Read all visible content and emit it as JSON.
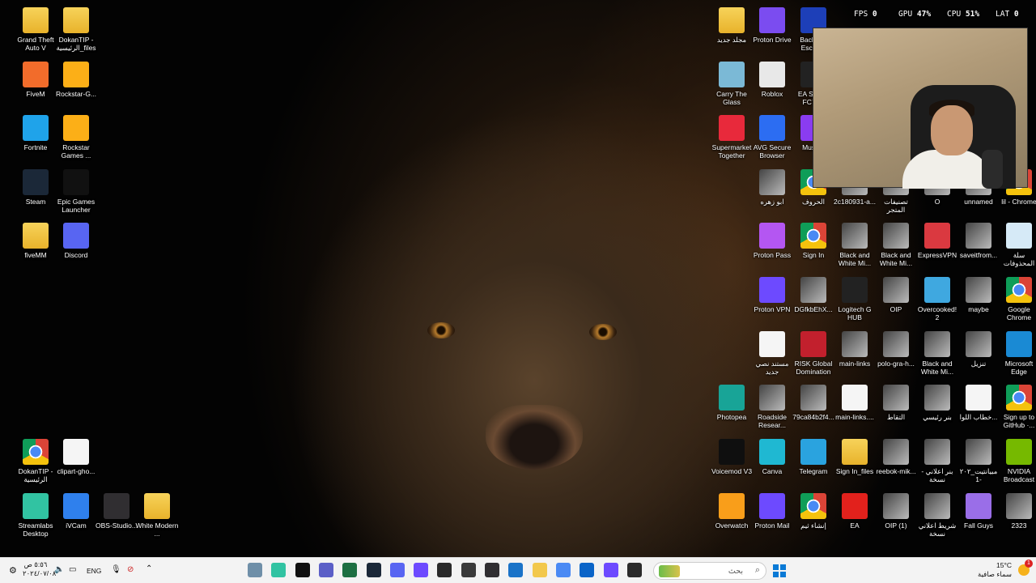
{
  "desktop": {
    "left_icons": [
      {
        "label": "Grand Theft Auto V",
        "icon": "folder-icon",
        "type": "folder"
      },
      {
        "label": "DokanTIP - الرئيسية_files",
        "icon": "folder-icon",
        "type": "folder"
      },
      {
        "label": "FiveM",
        "icon": "fivem-icon",
        "type": "app",
        "color": "#f26c2b"
      },
      {
        "label": "Rockstar-G...",
        "icon": "rockstar-icon",
        "type": "app",
        "color": "#fcaf17"
      },
      {
        "label": "Fortnite",
        "icon": "fortnite-icon",
        "type": "app",
        "color": "#1fa3ea"
      },
      {
        "label": "Rockstar Games ...",
        "icon": "rockstar-icon",
        "type": "app",
        "color": "#fcaf17"
      },
      {
        "label": "Steam",
        "icon": "steam-icon",
        "type": "app",
        "color": "#1b2838"
      },
      {
        "label": "Epic Games Launcher",
        "icon": "epic-games-icon",
        "type": "app",
        "color": "#111111"
      },
      {
        "label": "fiveMM",
        "icon": "folder-icon",
        "type": "folder"
      },
      {
        "label": "Discord",
        "icon": "discord-icon",
        "type": "app",
        "color": "#5865f2"
      },
      {
        "label": "DokanTIP - الرئيسية",
        "icon": "chrome-icon",
        "type": "chrome"
      },
      {
        "label": "clipart-gho...",
        "icon": "ghost-image-icon",
        "type": "file"
      },
      {
        "label": "Streamlabs Desktop",
        "icon": "streamlabs-icon",
        "type": "app",
        "color": "#31c3a2"
      },
      {
        "label": "iVCam",
        "icon": "ivcam-icon",
        "type": "app",
        "color": "#2f80ed"
      },
      {
        "label": "OBS-Studio...",
        "icon": "obs-icon",
        "type": "app",
        "color": "#302e31"
      },
      {
        "label": "White Modern ...",
        "icon": "folder-icon",
        "type": "folder"
      }
    ],
    "right_icons": [
      {
        "label": "مجلد جديد",
        "icon": "folder-icon",
        "type": "folder"
      },
      {
        "label": "Proton Drive",
        "icon": "proton-drive-icon",
        "type": "app",
        "color": "#7b4cf0"
      },
      {
        "label": "Backro... Escap...",
        "icon": "bet-icon",
        "type": "app",
        "color": "#1d3fb8"
      },
      {
        "label": "Carry The Glass",
        "icon": "carry-glass-icon",
        "type": "app",
        "color": "#7bb9d6"
      },
      {
        "label": "Roblox",
        "icon": "roblox-icon",
        "type": "app",
        "color": "#e8e8e8"
      },
      {
        "label": "EA SPO... FC™...",
        "icon": "ea-fc-icon",
        "type": "app",
        "color": "#222222"
      },
      {
        "label": "Supermarket Together",
        "icon": "supermarket-icon",
        "type": "app",
        "color": "#e8293b"
      },
      {
        "label": "AVG Secure Browser",
        "icon": "avg-icon",
        "type": "app",
        "color": "#2c6df2"
      },
      {
        "label": "Muse...",
        "icon": "muse-icon",
        "type": "app",
        "color": "#8a3cf0"
      },
      {
        "label": "ابو زهره",
        "icon": "photo-thumbnail-icon",
        "type": "thumb"
      },
      {
        "label": "الحروف",
        "icon": "chrome-icon",
        "type": "chrome"
      },
      {
        "label": "2c180931-a...",
        "icon": "photo-thumbnail-icon",
        "type": "thumb"
      },
      {
        "label": "تصنيفات المتجر",
        "icon": "photo-thumbnail-icon",
        "type": "thumb"
      },
      {
        "label": "O",
        "icon": "photo-thumbnail-icon",
        "type": "thumb"
      },
      {
        "label": "unnamed",
        "icon": "photo-thumbnail-icon",
        "type": "thumb"
      },
      {
        "label": "lil - Chrome",
        "icon": "chrome-icon",
        "type": "chrome"
      },
      {
        "label": "Proton Pass",
        "icon": "proton-pass-icon",
        "type": "app",
        "color": "#b456f2"
      },
      {
        "label": "Sign In",
        "icon": "chrome-icon",
        "type": "chrome"
      },
      {
        "label": "Black and White Mi...",
        "icon": "photo-thumbnail-icon",
        "type": "thumb"
      },
      {
        "label": "Black and White Mi...",
        "icon": "photo-thumbnail-icon",
        "type": "thumb"
      },
      {
        "label": "ExpressVPN",
        "icon": "expressvpn-icon",
        "type": "app",
        "color": "#da3940"
      },
      {
        "label": "saveitfrom...",
        "icon": "photo-thumbnail-icon",
        "type": "thumb"
      },
      {
        "label": "سلة المحذوفات",
        "icon": "recycle-bin-icon",
        "type": "app",
        "color": "#d6eaf7"
      },
      {
        "label": "Proton VPN",
        "icon": "proton-vpn-icon",
        "type": "app",
        "color": "#6d4aff"
      },
      {
        "label": "DGfkbEhX...",
        "icon": "photo-thumbnail-icon",
        "type": "thumb"
      },
      {
        "label": "Logitech G HUB",
        "icon": "logitech-icon",
        "type": "app",
        "color": "#222222"
      },
      {
        "label": "OIP",
        "icon": "photo-thumbnail-icon",
        "type": "thumb"
      },
      {
        "label": "Overcooked! 2",
        "icon": "overcooked-icon",
        "type": "app",
        "color": "#3fa8e0"
      },
      {
        "label": "maybe",
        "icon": "photo-thumbnail-icon",
        "type": "thumb"
      },
      {
        "label": "Google Chrome",
        "icon": "chrome-icon",
        "type": "chrome"
      },
      {
        "label": "مستند نصي جديد",
        "icon": "text-file-icon",
        "type": "file"
      },
      {
        "label": "RISK Global Domination",
        "icon": "risk-icon",
        "type": "app",
        "color": "#c2202d"
      },
      {
        "label": "main-links",
        "icon": "photo-thumbnail-icon",
        "type": "thumb"
      },
      {
        "label": "polo-gra-h...",
        "icon": "photo-thumbnail-icon",
        "type": "thumb"
      },
      {
        "label": "Black and White Mi...",
        "icon": "photo-thumbnail-icon",
        "type": "thumb"
      },
      {
        "label": "تنزيل",
        "icon": "photo-thumbnail-icon",
        "type": "thumb"
      },
      {
        "label": "Microsoft Edge",
        "icon": "edge-icon",
        "type": "app",
        "color": "#1a8ad4"
      },
      {
        "label": "Photopea",
        "icon": "photopea-icon",
        "type": "app",
        "color": "#18a497"
      },
      {
        "label": "Roadside Resear...",
        "icon": "photo-thumbnail-icon",
        "type": "thumb"
      },
      {
        "label": "79ca84b2f4...",
        "icon": "photo-thumbnail-icon",
        "type": "thumb"
      },
      {
        "label": "main-links....",
        "icon": "text-file-icon",
        "type": "file"
      },
      {
        "label": "التقاط",
        "icon": "photo-thumbnail-icon",
        "type": "thumb"
      },
      {
        "label": "بنر رئيسي",
        "icon": "photo-thumbnail-icon",
        "type": "thumb"
      },
      {
        "label": "خطاب اللوا...",
        "icon": "text-file-icon",
        "type": "file"
      },
      {
        "label": "Sign up to GitHub ·...",
        "icon": "chrome-icon",
        "type": "chrome"
      },
      {
        "label": "Voicemod V3",
        "icon": "voicemod-icon",
        "type": "app",
        "color": "#0f0f0f"
      },
      {
        "label": "Canva",
        "icon": "canva-icon",
        "type": "app",
        "color": "#1fb8d2"
      },
      {
        "label": "Telegram",
        "icon": "telegram-icon",
        "type": "app",
        "color": "#2aa3df"
      },
      {
        "label": "Sign In_files",
        "icon": "folder-icon",
        "type": "folder"
      },
      {
        "label": "reebok-mik...",
        "icon": "photo-thumbnail-icon",
        "type": "thumb"
      },
      {
        "label": "بنر اعلاني - نسخة",
        "icon": "photo-thumbnail-icon",
        "type": "thumb"
      },
      {
        "label": "مبيانتيت_٢٠٢ -1",
        "icon": "photo-thumbnail-icon",
        "type": "thumb"
      },
      {
        "label": "NVIDIA Broadcast",
        "icon": "nvidia-icon",
        "type": "app",
        "color": "#76b900"
      },
      {
        "label": "Overwatch",
        "icon": "overwatch-icon",
        "type": "app",
        "color": "#f99e1a"
      },
      {
        "label": "Proton Mail",
        "icon": "proton-mail-icon",
        "type": "app",
        "color": "#6d4aff"
      },
      {
        "label": "إنشاء ثيم",
        "icon": "chrome-icon",
        "type": "chrome"
      },
      {
        "label": "EA",
        "icon": "ea-icon",
        "type": "app",
        "color": "#e2211c"
      },
      {
        "label": "OIP (1)",
        "icon": "photo-thumbnail-icon",
        "type": "thumb"
      },
      {
        "label": "شريط اعلاني نسخة",
        "icon": "photo-thumbnail-icon",
        "type": "thumb"
      },
      {
        "label": "Fall Guys",
        "icon": "fall-guys-icon",
        "type": "app",
        "color": "#9a6ee8"
      },
      {
        "label": "2323",
        "icon": "photo-thumbnail-icon",
        "type": "thumb"
      }
    ]
  },
  "overlay": {
    "fps_label": "FPS",
    "fps_value": "0",
    "gpu_label": "GPU",
    "gpu_value": "47%",
    "cpu_label": "CPU",
    "cpu_value": "51%",
    "lat_label": "LAT",
    "lat_value": "0"
  },
  "taskbar": {
    "search_placeholder": "بحث",
    "language": "ENG",
    "time": "٥:٥٦ ص",
    "date": "٢٠٢٤/٠٧/٠٨",
    "weather_temp": "15°C",
    "weather_desc": "سماء صافية",
    "notification_count": "1",
    "pinned": [
      {
        "icon": "photos-icon",
        "color": "#6f8fa8"
      },
      {
        "icon": "streamlabs-icon",
        "color": "#31c3a2"
      },
      {
        "icon": "capcut-icon",
        "color": "#111111"
      },
      {
        "icon": "teams-icon",
        "color": "#5b5fc7"
      },
      {
        "icon": "excel-icon",
        "color": "#1d6f42"
      },
      {
        "icon": "steam-icon",
        "color": "#1b2838"
      },
      {
        "icon": "discord-icon",
        "color": "#5865f2"
      },
      {
        "icon": "headset-icon",
        "color": "#6d4aff"
      },
      {
        "icon": "epic-games-icon",
        "color": "#2a2a2a"
      },
      {
        "icon": "unity-icon",
        "color": "#3a3a3a"
      },
      {
        "icon": "obs-icon",
        "color": "#302e31"
      },
      {
        "icon": "vscode-icon",
        "color": "#1a73c8"
      },
      {
        "icon": "file-explorer-icon",
        "color": "#f2c84b"
      },
      {
        "icon": "chrome-icon",
        "color": "#4a8af4"
      },
      {
        "icon": "outlook-icon",
        "color": "#0a64c8"
      },
      {
        "icon": "proton-vpn-icon",
        "color": "#6d4aff"
      },
      {
        "icon": "terminal-icon",
        "color": "#2b2b2b"
      }
    ]
  }
}
